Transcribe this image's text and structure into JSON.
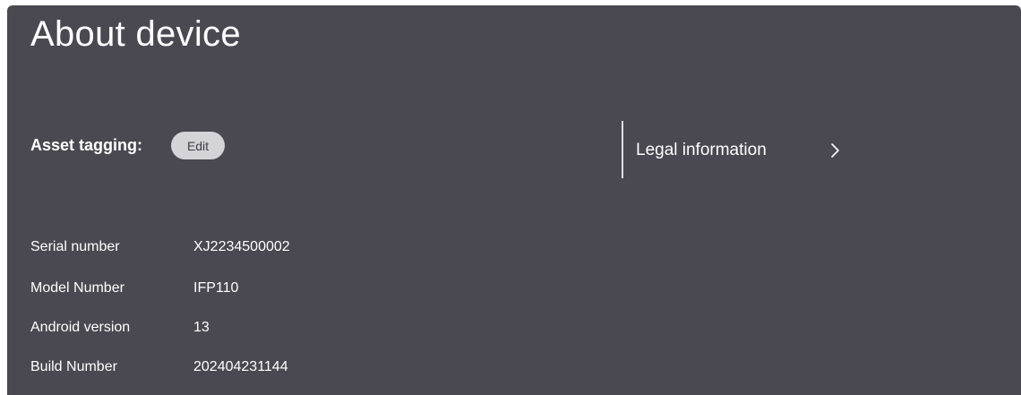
{
  "page": {
    "title": "About device"
  },
  "asset_tagging": {
    "label": "Asset tagging:",
    "edit_label": "Edit"
  },
  "legal": {
    "label": "Legal information",
    "icon": "chevron-right-icon"
  },
  "info": [
    {
      "label": "Serial number",
      "value": "XJ2234500002"
    },
    {
      "label": "Model Number",
      "value": "IFP110"
    },
    {
      "label": "Android version",
      "value": "13"
    },
    {
      "label": "Build Number",
      "value": "202404231144"
    }
  ],
  "colors": {
    "panel_bg": "#4a4850",
    "edit_button_bg": "#d4d3d8",
    "text": "#ffffff"
  }
}
